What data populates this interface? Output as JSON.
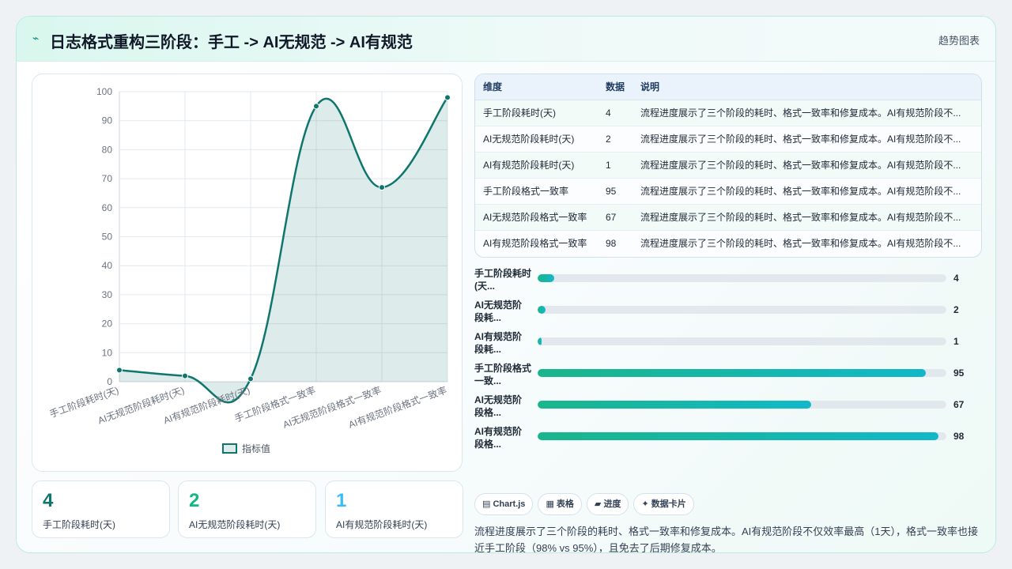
{
  "header": {
    "icon": "sparkline-icon",
    "title": "日志格式重构三阶段：手工 -> AI无规范 -> AI有规范",
    "tag": "趋势图表"
  },
  "chart_data": {
    "type": "area",
    "categories": [
      "手工阶段耗时(天)",
      "AI无规范阶段耗时(天)",
      "AI有规范阶段耗时(天)",
      "手工阶段格式一致率",
      "AI无规范阶段格式一致率",
      "AI有规范阶段格式一致率"
    ],
    "series": [
      {
        "name": "指标值",
        "values": [
          4,
          2,
          1,
          95,
          67,
          98
        ]
      }
    ],
    "ylim": [
      0,
      100
    ],
    "yticks": [
      0,
      10,
      20,
      30,
      40,
      50,
      60,
      70,
      80,
      90,
      100
    ],
    "legend": "bottom",
    "grid": true,
    "color": "#0f766e"
  },
  "kpis": [
    {
      "value": "4",
      "label": "手工阶段耗时(天)",
      "color": "#0f766e"
    },
    {
      "value": "2",
      "label": "AI无规范阶段耗时(天)",
      "color": "#10b981"
    },
    {
      "value": "1",
      "label": "AI有规范阶段耗时(天)",
      "color": "#38bdf8"
    }
  ],
  "table": {
    "headers": [
      "维度",
      "数据",
      "说明"
    ],
    "rows": [
      [
        "手工阶段耗时(天)",
        "4",
        "流程进度展示了三个阶段的耗时、格式一致率和修复成本。AI有规范阶段不..."
      ],
      [
        "AI无规范阶段耗时(天)",
        "2",
        "流程进度展示了三个阶段的耗时、格式一致率和修复成本。AI有规范阶段不..."
      ],
      [
        "AI有规范阶段耗时(天)",
        "1",
        "流程进度展示了三个阶段的耗时、格式一致率和修复成本。AI有规范阶段不..."
      ],
      [
        "手工阶段格式一致率",
        "95",
        "流程进度展示了三个阶段的耗时、格式一致率和修复成本。AI有规范阶段不..."
      ],
      [
        "AI无规范阶段格式一致率",
        "67",
        "流程进度展示了三个阶段的耗时、格式一致率和修复成本。AI有规范阶段不..."
      ],
      [
        "AI有规范阶段格式一致率",
        "98",
        "流程进度展示了三个阶段的耗时、格式一致率和修复成本。AI有规范阶段不..."
      ]
    ]
  },
  "progress": [
    {
      "label_1": "手工阶段耗时",
      "label_2": "(天...",
      "value": "4",
      "fraction": 0.04
    },
    {
      "label_1": "AI无规范阶",
      "label_2": "段耗...",
      "value": "2",
      "fraction": 0.02
    },
    {
      "label_1": "AI有规范阶",
      "label_2": "段耗...",
      "value": "1",
      "fraction": 0.01
    },
    {
      "label_1": "手工阶段格式",
      "label_2": "一致...",
      "value": "95",
      "fraction": 0.95
    },
    {
      "label_1": "AI无规范阶",
      "label_2": "段格...",
      "value": "67",
      "fraction": 0.67
    },
    {
      "label_1": "AI有规范阶",
      "label_2": "段格...",
      "value": "98",
      "fraction": 0.98
    }
  ],
  "chips": [
    {
      "icon": "chart-icon",
      "glyph": "▤",
      "label": "Chart.js"
    },
    {
      "icon": "table-icon",
      "glyph": "▦",
      "label": "表格"
    },
    {
      "icon": "progress-icon",
      "glyph": "▰",
      "label": "进度"
    },
    {
      "icon": "card-icon",
      "glyph": "✦",
      "label": "数据卡片"
    }
  ],
  "summary": "流程进度展示了三个阶段的耗时、格式一致率和修复成本。AI有规范阶段不仅效率最高（1天），格式一致率也接近手工阶段（98% vs 95%），且免去了后期修复成本。"
}
